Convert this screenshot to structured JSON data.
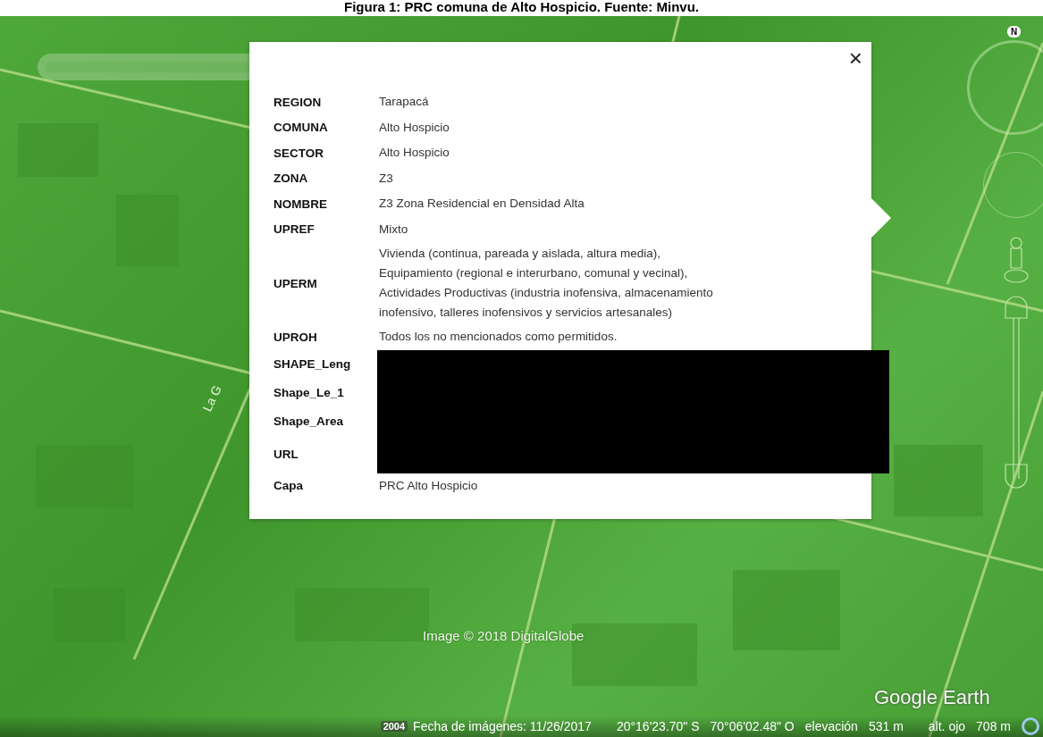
{
  "caption": "Figura 1: PRC comuna de Alto Hospicio. Fuente: Minvu.",
  "map": {
    "street_label": "La G",
    "imagery_credit": "Image © 2018 DigitalGlobe",
    "logo": "Google Earth",
    "compass_letter": "N"
  },
  "popup": {
    "close": "×",
    "rows": [
      {
        "label": "REGION",
        "value": "Tarapacá",
        "redacted": false
      },
      {
        "label": "COMUNA",
        "value": "Alto Hospicio",
        "redacted": false
      },
      {
        "label": "SECTOR",
        "value": "Alto Hospicio",
        "redacted": false
      },
      {
        "label": "ZONA",
        "value": "Z3",
        "redacted": false
      },
      {
        "label": "NOMBRE",
        "value": "Z3 Zona Residencial en Densidad Alta",
        "redacted": false
      },
      {
        "label": "UPREF",
        "value": "Mixto",
        "redacted": false
      },
      {
        "label": "UPERM",
        "value": "Vivienda (continua, pareada y aislada, altura media),\nEquipamiento (regional e interurbano, comunal y vecinal),\nActividades Productivas (industria inofensiva, almacenamiento\ninofensivo, talleres inofensivos y servicios artesanales)",
        "redacted": false
      },
      {
        "label": "UPROH",
        "value": "Todos los no mencionados como permitidos.",
        "redacted": false
      },
      {
        "label": "SHAPE_Leng",
        "redacted": true
      },
      {
        "label": "Shape_Le_1",
        "redacted": true
      },
      {
        "label": "Shape_Area",
        "redacted": true
      },
      {
        "label": "URL",
        "redacted": true
      },
      {
        "label": "Capa",
        "value": "PRC Alto Hospicio",
        "redacted": false
      }
    ]
  },
  "status_bar": {
    "year_tag": "2004",
    "date": "Fecha de imágenes: 11/26/2017",
    "latitude": "20°16'23.70\" S",
    "longitude": "70°06'02.48\" O",
    "elevation_label": "elevación",
    "elevation": "531 m",
    "eye_label": "alt. ojo",
    "eye_altitude": "708 m"
  }
}
